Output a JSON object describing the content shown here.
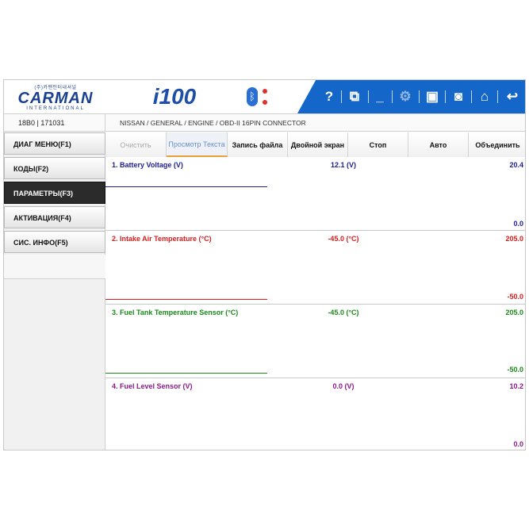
{
  "header": {
    "logo_top": "(주)카맨인터내셔널",
    "logo_brand": "CARMAN",
    "logo_sub": "INTERNATIONAL",
    "model": "i100",
    "bluetooth_glyph": "ᛒ",
    "toolbar_icons": [
      {
        "name": "help-icon",
        "glyph": "?"
      },
      {
        "name": "window-icon",
        "glyph": "⧉"
      },
      {
        "name": "minimize-icon",
        "glyph": "_"
      },
      {
        "name": "settings-icon",
        "glyph": "⚙"
      },
      {
        "name": "save-icon",
        "glyph": "▣"
      },
      {
        "name": "camera-icon",
        "glyph": "◙"
      },
      {
        "name": "home-icon",
        "glyph": "⌂"
      },
      {
        "name": "back-icon",
        "glyph": "↩"
      }
    ],
    "colors": {
      "toolbar": "#1467c8",
      "brand": "#1a3f8f"
    }
  },
  "subheader": {
    "vin_info": "18B0  |    171031",
    "vehicle_path": "NISSAN / GENERAL / ENGINE / OBD-II 16PIN CONNECTOR"
  },
  "sidebar": {
    "items": [
      {
        "label": "ДИАГ МЕНЮ(F1)",
        "active": false
      },
      {
        "label": "КОДЫ(F2)",
        "active": false
      },
      {
        "label": "ПАРАМЕТРЫ(F3)",
        "active": true
      },
      {
        "label": "АКТИВАЦИЯ(F4)",
        "active": false
      },
      {
        "label": "СИС. ИНФО(F5)",
        "active": false
      }
    ]
  },
  "actions": [
    {
      "label": "Очистить",
      "state": "disabled"
    },
    {
      "label": "Просмотр Текста",
      "state": "selected"
    },
    {
      "label": "Запись файла",
      "state": "normal"
    },
    {
      "label": "Двойной экран",
      "state": "normal"
    },
    {
      "label": "Стоп",
      "state": "normal"
    },
    {
      "label": "Авто",
      "state": "normal"
    },
    {
      "label": "Объединить",
      "state": "normal"
    }
  ],
  "panels": [
    {
      "name": "1. Battery Voltage (V)",
      "value": "12.1 (V)",
      "max": "20.4",
      "min": "0.0",
      "color": "#1d1d9a"
    },
    {
      "name": "2. Intake Air Temperature (°C)",
      "value": "-45.0 (°C)",
      "max": "205.0",
      "min": "-50.0",
      "color": "#d81e1e"
    },
    {
      "name": "3. Fuel Tank Temperature Sensor (°C)",
      "value": "-45.0 (°C)",
      "max": "205.0",
      "min": "-50.0",
      "color": "#1a8a1a"
    },
    {
      "name": "4. Fuel Level Sensor (V)",
      "value": "0.0 (V)",
      "max": "10.2",
      "min": "0.0",
      "color": "#8a1a8a"
    }
  ]
}
